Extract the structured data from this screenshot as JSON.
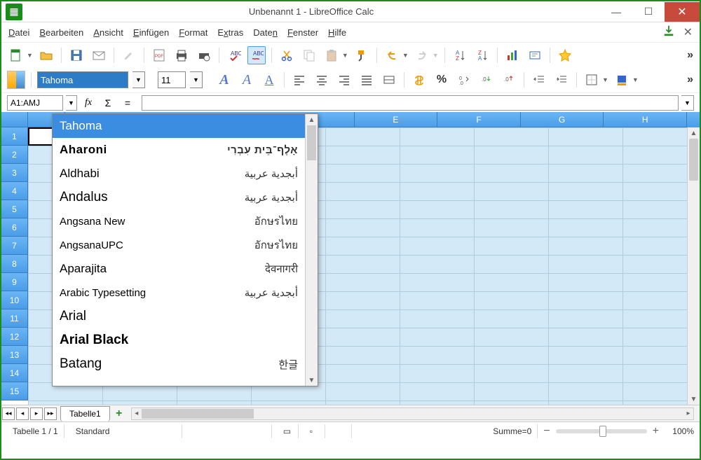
{
  "window": {
    "title": "Unbenannt 1 - LibreOffice Calc"
  },
  "menu": {
    "items": [
      "Datei",
      "Bearbeiten",
      "Ansicht",
      "Einfügen",
      "Format",
      "Extras",
      "Daten",
      "Fenster",
      "Hilfe"
    ]
  },
  "format": {
    "font_name": "Tahoma",
    "font_size": "11"
  },
  "cellref": "A1:AMJ",
  "font_dropdown": {
    "items": [
      {
        "name": "Tahoma",
        "preview": "",
        "cls": "",
        "selected": true
      },
      {
        "name": "Aharoni",
        "preview": "אָלֶף־בֵּית עִבְרִי",
        "cls": "aharoni"
      },
      {
        "name": "Aldhabi",
        "preview": "أبجدية عربية",
        "cls": ""
      },
      {
        "name": "Andalus",
        "preview": "أبجدية عربية",
        "cls": "andalus"
      },
      {
        "name": "Angsana New",
        "preview": "อักษรไทย",
        "cls": "angsana"
      },
      {
        "name": "AngsanaUPC",
        "preview": "อักษรไทย",
        "cls": "angsana"
      },
      {
        "name": "Aparajita",
        "preview": "देवनागरी",
        "cls": "aparajita"
      },
      {
        "name": "Arabic Typesetting",
        "preview": "أبجدية عربية",
        "cls": "arabictype"
      },
      {
        "name": "Arial",
        "preview": "",
        "cls": "arial"
      },
      {
        "name": "Arial Black",
        "preview": "",
        "cls": "arialblack"
      },
      {
        "name": "Batang",
        "preview": "한글",
        "cls": "batang"
      }
    ]
  },
  "columns": [
    "E",
    "F",
    "G",
    "H"
  ],
  "rows": [
    "1",
    "2",
    "3",
    "4",
    "5",
    "6",
    "7",
    "8",
    "9",
    "10",
    "11",
    "12",
    "13",
    "14",
    "15"
  ],
  "tabs": {
    "sheet1": "Tabelle1"
  },
  "status": {
    "sheet": "Tabelle 1 / 1",
    "style": "Standard",
    "sum": "Summe=0",
    "zoom": "100%"
  }
}
